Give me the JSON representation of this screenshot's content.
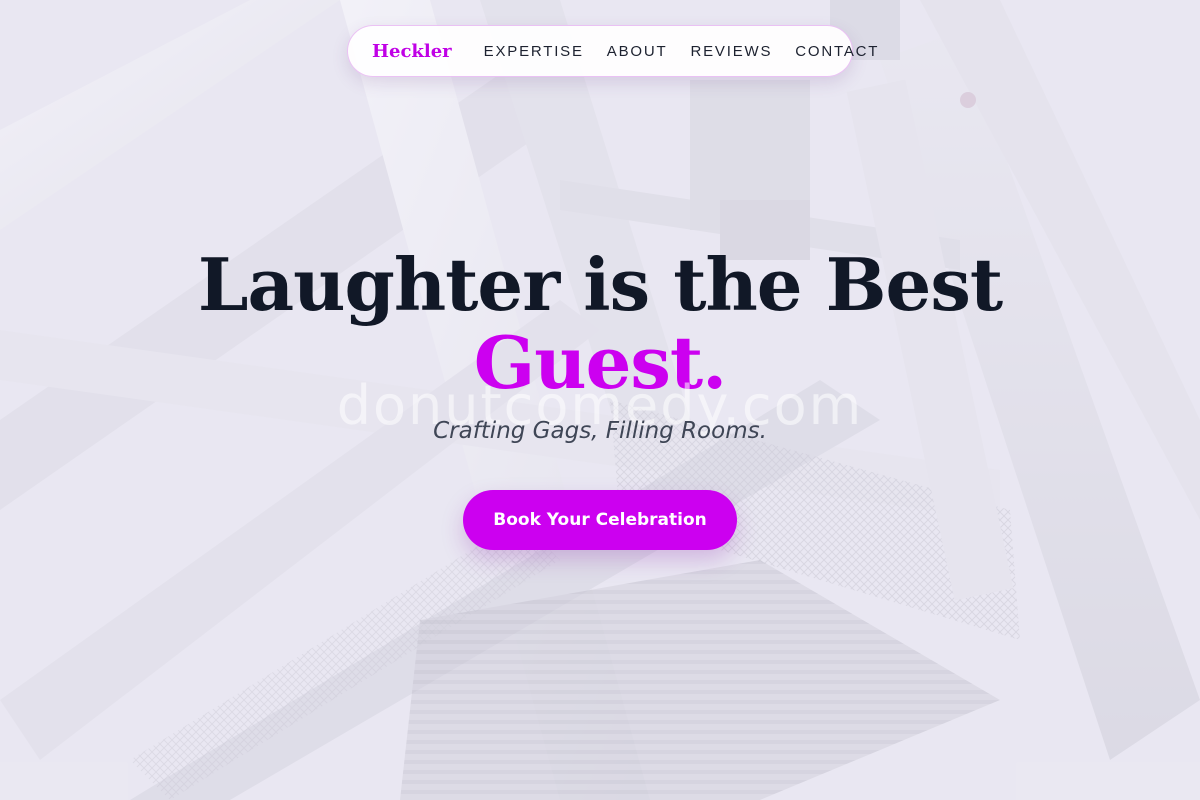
{
  "brand": {
    "name": "Heckler",
    "accent_color": "#cc00f0"
  },
  "nav": {
    "links": [
      "EXPERTISE",
      "ABOUT",
      "REVIEWS",
      "CONTACT"
    ]
  },
  "hero": {
    "headline_line1": "Laughter is the Best",
    "headline_line2": "Guest.",
    "watermark": "donutcomedy.com",
    "tagline": "Crafting Gags, Filling Rooms.",
    "cta_label": "Book Your Celebration",
    "background_image": "steel-scaffolding-structure"
  },
  "colors": {
    "headline": "#111827",
    "accent": "#cc00f0",
    "tagline": "#3f4656",
    "nav_text": "#1d2230"
  }
}
